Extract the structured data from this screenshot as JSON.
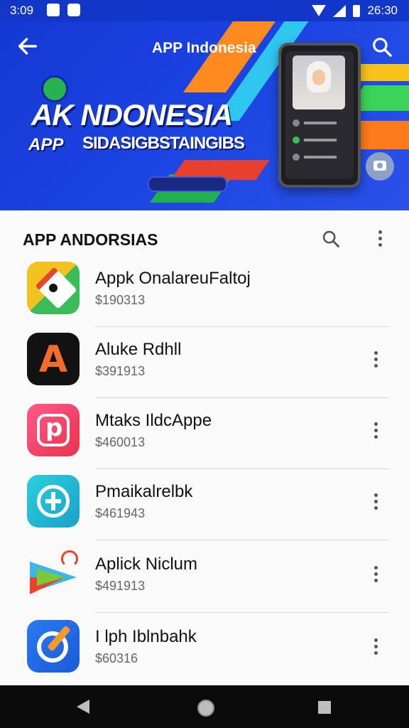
{
  "status_bar": {
    "time": "3:09",
    "right_time": "26:30"
  },
  "banner": {
    "title": "APP Indonesia",
    "headline": "AK NDONESIA",
    "app_tag": "APP",
    "subtitle": "SIDASIGBSTAINGIBS"
  },
  "section": {
    "title": "APP ANDORSIAS"
  },
  "apps": [
    {
      "name": "Appk OnalareuFaltoj",
      "size": "$190313"
    },
    {
      "name": "Aluke Rdhll",
      "size": "$391913"
    },
    {
      "name": "Mtaks IldcAppe",
      "size": "$460013"
    },
    {
      "name": "Pmaikalrelbk",
      "size": "$461943"
    },
    {
      "name": "Aplick Niclum",
      "size": "$491913"
    },
    {
      "name": "I lph Iblnbahk",
      "size": "$60316"
    }
  ],
  "colors": {
    "banner_blue": "#1438d4",
    "accent_orange": "#ff8a1f",
    "accent_green": "#3bd35a"
  },
  "icons": {
    "top_left": "back-arrow-icon",
    "top_right": "search-icon",
    "section_search": "search-icon",
    "section_more": "more-vert-icon",
    "camera": "camera-icon"
  }
}
